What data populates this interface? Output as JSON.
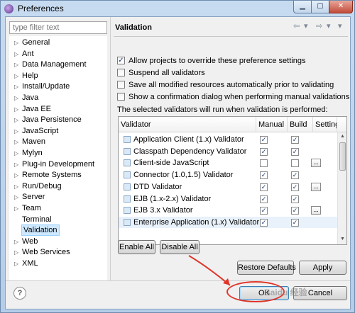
{
  "window": {
    "title": "Preferences"
  },
  "filter": {
    "placeholder": "type filter text"
  },
  "tree": [
    {
      "label": "General",
      "arrow": true
    },
    {
      "label": "Ant",
      "arrow": true
    },
    {
      "label": "Data Management",
      "arrow": true
    },
    {
      "label": "Help",
      "arrow": true
    },
    {
      "label": "Install/Update",
      "arrow": true
    },
    {
      "label": "Java",
      "arrow": true
    },
    {
      "label": "Java EE",
      "arrow": true
    },
    {
      "label": "Java Persistence",
      "arrow": true
    },
    {
      "label": "JavaScript",
      "arrow": true
    },
    {
      "label": "Maven",
      "arrow": true
    },
    {
      "label": "Mylyn",
      "arrow": true
    },
    {
      "label": "Plug-in Development",
      "arrow": true
    },
    {
      "label": "Remote Systems",
      "arrow": true
    },
    {
      "label": "Run/Debug",
      "arrow": true
    },
    {
      "label": "Server",
      "arrow": true
    },
    {
      "label": "Team",
      "arrow": true
    },
    {
      "label": "Terminal",
      "arrow": false
    },
    {
      "label": "Validation",
      "arrow": false,
      "selected": true
    },
    {
      "label": "Web",
      "arrow": true
    },
    {
      "label": "Web Services",
      "arrow": true
    },
    {
      "label": "XML",
      "arrow": true
    }
  ],
  "page": {
    "title": "Validation",
    "options": [
      {
        "label": "Allow projects to override these preference settings",
        "checked": true
      },
      {
        "label": "Suspend all validators",
        "checked": false
      },
      {
        "label": "Save all modified resources automatically prior to validating",
        "checked": false
      },
      {
        "label": "Show a confirmation dialog when performing manual validations",
        "checked": false
      }
    ],
    "table_caption": "The selected validators will run when validation is performed:",
    "columns": [
      "Validator",
      "Manual",
      "Build",
      "Settings"
    ],
    "rows": [
      {
        "name": "Application Client (1.x) Validator",
        "manual": true,
        "build": true,
        "settings": false
      },
      {
        "name": "Classpath Dependency Validator",
        "manual": true,
        "build": true,
        "settings": false
      },
      {
        "name": "Client-side JavaScript",
        "manual": false,
        "build": false,
        "settings": true
      },
      {
        "name": "Connector (1.0,1.5) Validator",
        "manual": true,
        "build": true,
        "settings": false
      },
      {
        "name": "DTD Validator",
        "manual": true,
        "build": true,
        "settings": true
      },
      {
        "name": "EJB (1.x-2.x) Validator",
        "manual": true,
        "build": true,
        "settings": false
      },
      {
        "name": "EJB 3.x Validator",
        "manual": true,
        "build": true,
        "settings": true
      },
      {
        "name": "Enterprise Application (1.x) Validator",
        "manual": true,
        "build": true,
        "settings": false
      }
    ],
    "enable_all": "Enable All",
    "disable_all": "Disable All",
    "restore_defaults": "Restore Defaults",
    "apply": "Apply"
  },
  "footer": {
    "ok": "OK",
    "cancel": "Cancel",
    "help_symbol": "?"
  },
  "watermark": "Baidu 经验",
  "colors": {
    "selection": "#cde8ff",
    "annotation": "#e0362a"
  }
}
